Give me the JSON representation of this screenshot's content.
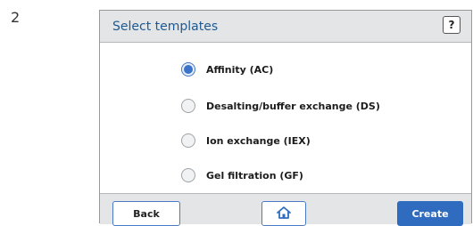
{
  "page": {
    "step_number": "2"
  },
  "dialog": {
    "title": "Select templates",
    "help_label": "?",
    "options": [
      {
        "label": "Affinity (AC)",
        "selected": true
      },
      {
        "label": "Desalting/buffer exchange (DS)",
        "selected": false
      },
      {
        "label": "Ion exchange (IEX)",
        "selected": false
      },
      {
        "label": "Gel filtration (GF)",
        "selected": false
      }
    ],
    "footer": {
      "back_label": "Back",
      "home_icon": "home-icon",
      "create_label": "Create"
    }
  },
  "colors": {
    "title": "#1f5a92",
    "accent": "#2f6cc0",
    "header_bg": "#e3e5e6"
  }
}
